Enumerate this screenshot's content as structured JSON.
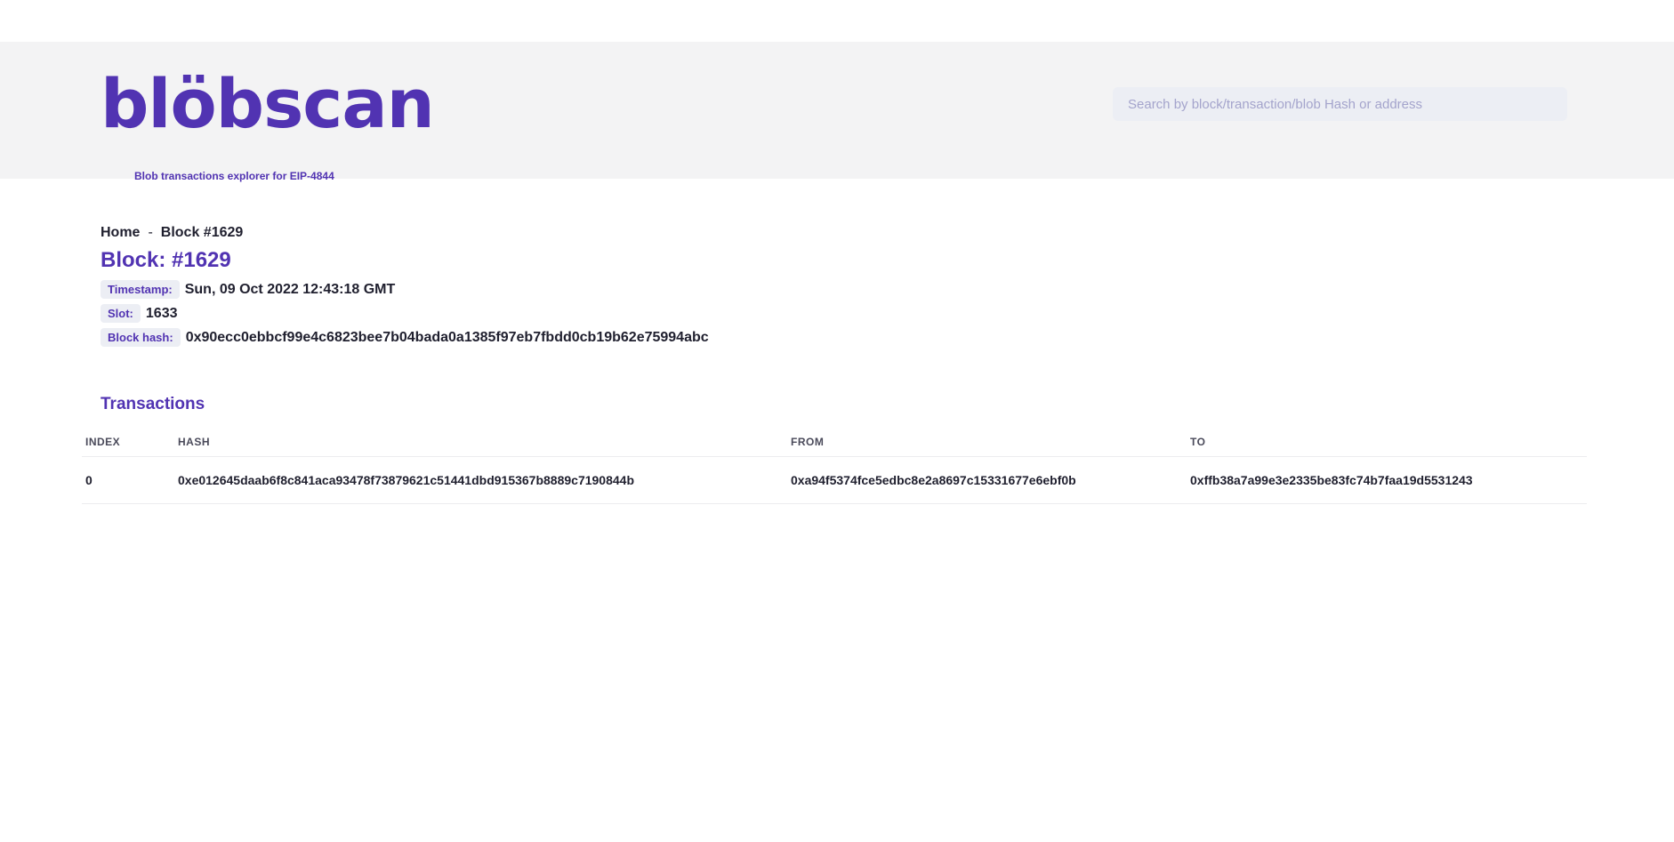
{
  "header": {
    "logo_text": "blöbscan",
    "tagline": "Blob transactions explorer for EIP-4844",
    "search_placeholder": "Search by block/transaction/blob Hash or address",
    "brand_color": "#5133b2",
    "background_color": "#f3f3f4"
  },
  "breadcrumb": {
    "home": "Home",
    "separator": "-",
    "current": "Block #1629"
  },
  "block": {
    "title": "Block: #1629",
    "timestamp_label": "Timestamp:",
    "timestamp": "Sun, 09 Oct 2022 12:43:18 GMT",
    "slot_label": "Slot:",
    "slot": "1633",
    "hash_label": "Block hash:",
    "hash": "0x90ecc0ebbcf99e4c6823bee7b04bada0a1385f97eb7fbdd0cb19b62e75994abc"
  },
  "transactions": {
    "title": "Transactions",
    "columns": [
      "INDEX",
      "HASH",
      "FROM",
      "TO"
    ],
    "rows": [
      {
        "index": "0",
        "hash": "0xe012645daab6f8c841aca93478f73879621c51441dbd915367b8889c7190844b",
        "from": "0xa94f5374fce5edbc8e2a8697c15331677e6ebf0b",
        "to": "0xffb38a7a99e3e2335be83fc74b7faa19d5531243"
      }
    ]
  }
}
